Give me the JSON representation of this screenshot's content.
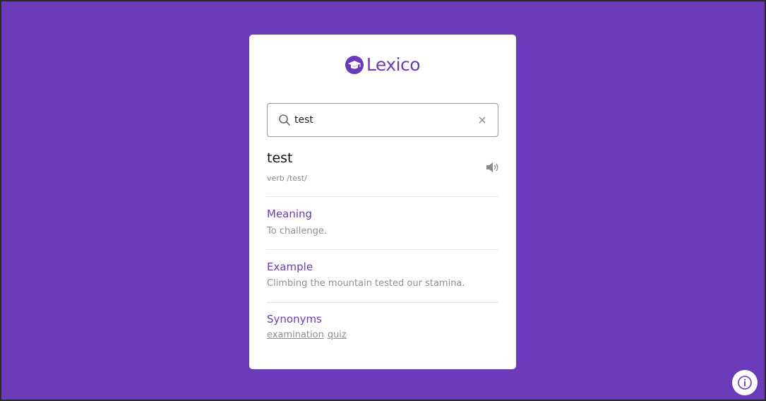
{
  "app": {
    "name": "Lexico",
    "accent_color": "#6a3bb8",
    "background_color": "#6a3bb8"
  },
  "search": {
    "value": "test",
    "icon": "search-icon",
    "clear_icon": "close-icon"
  },
  "entry": {
    "word": "test",
    "phonetic": "verb /test/",
    "audio_icon": "speaker-icon"
  },
  "sections": {
    "meaning": {
      "title": "Meaning",
      "text": "To challenge."
    },
    "example": {
      "title": "Example",
      "text": "Climbing the mountain tested our stamina."
    },
    "synonyms": {
      "title": "Synonyms",
      "items": [
        "examination",
        "quiz"
      ]
    }
  },
  "info_button": {
    "icon": "info-icon"
  }
}
